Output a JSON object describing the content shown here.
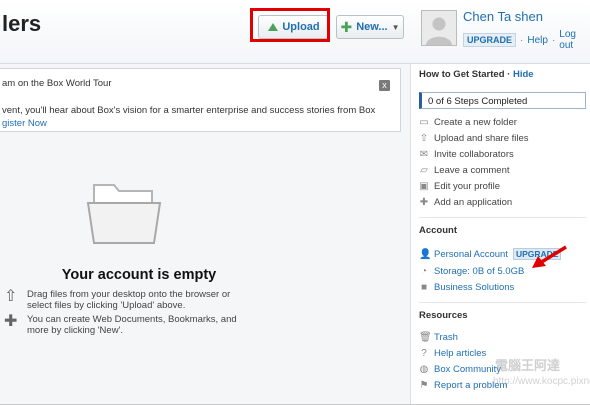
{
  "header": {
    "title": "lers",
    "upload_label": "Upload",
    "new_label": "New...",
    "user_name": "Chen Ta shen",
    "upgrade_label": "UPGRADE",
    "help_label": "Help",
    "logout_label": "Log out",
    "separator": "·"
  },
  "notice": {
    "title": "am on the Box World Tour",
    "body": "vent, you'll hear about Box's vision for a smarter enterprise and success stories from Box",
    "link": "gister Now",
    "close": "x"
  },
  "empty": {
    "title": "Your account is empty",
    "hint1": "Drag files from your desktop onto the browser or select files by clicking 'Upload' above.",
    "hint2": "You can create Web Documents, Bookmarks, and more by clicking 'New'."
  },
  "sidebar": {
    "getting_started_heading": "How to Get Started",
    "hide_label": "Hide",
    "progress": "0 of 6 Steps Completed",
    "steps": [
      {
        "label": "Create a new folder",
        "icon": "folder-icon"
      },
      {
        "label": "Upload and share files",
        "icon": "upload-icon"
      },
      {
        "label": "Invite collaborators",
        "icon": "mail-icon"
      },
      {
        "label": "Leave a comment",
        "icon": "comment-icon"
      },
      {
        "label": "Edit your profile",
        "icon": "profile-icon"
      },
      {
        "label": "Add an application",
        "icon": "plus-icon"
      }
    ],
    "account_heading": "Account",
    "account_items": [
      {
        "label": "Personal Account",
        "badge": "UPGRADE",
        "icon": "user-icon"
      },
      {
        "label": "Storage: 0B of 5.0GB",
        "icon": "pie-icon"
      },
      {
        "label": "Business Solutions",
        "icon": "briefcase-icon"
      }
    ],
    "resources_heading": "Resources",
    "resources": [
      {
        "label": "Trash",
        "icon": "trash-icon"
      },
      {
        "label": "Help articles",
        "icon": "help-icon"
      },
      {
        "label": "Box Community",
        "icon": "community-icon"
      },
      {
        "label": "Report a problem",
        "icon": "report-icon"
      }
    ]
  },
  "watermark": {
    "line1": "電腦王阿達",
    "line2": "http://www.kocpc.pixnet.net"
  },
  "colors": {
    "accent": "#1f6fb2",
    "highlight": "#e00000",
    "green": "#4ba35a"
  }
}
